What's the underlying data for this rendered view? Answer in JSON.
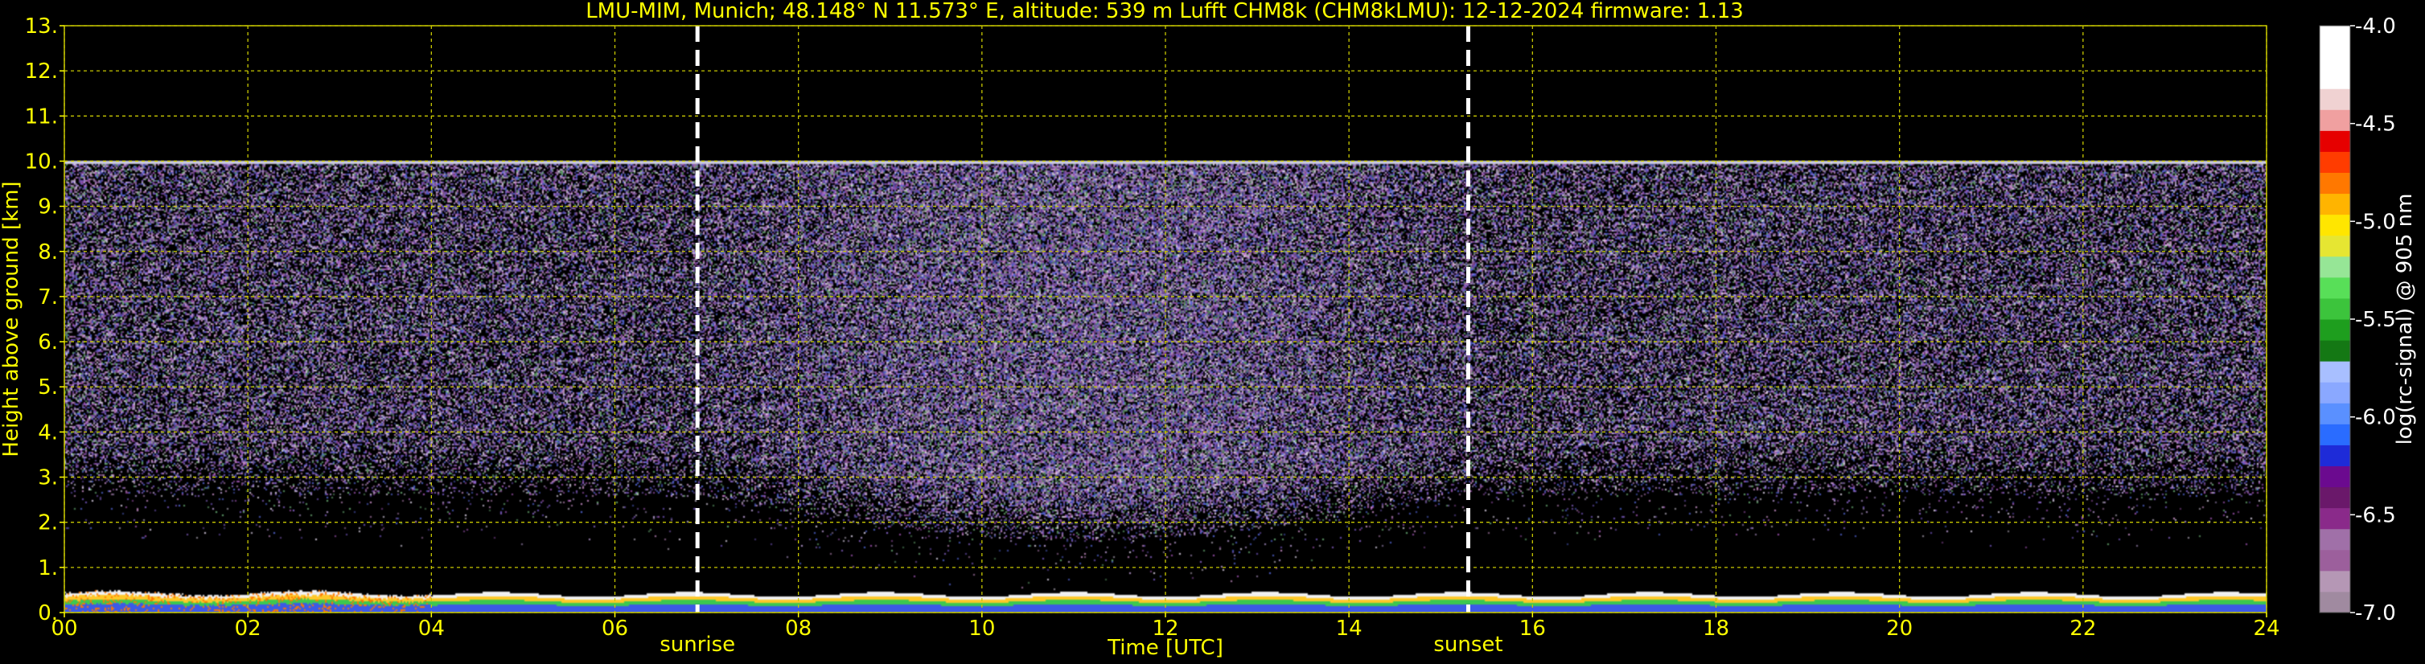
{
  "chart_data": {
    "type": "heatmap",
    "title": "LMU-MIM, Munich; 48.148° N 11.573° E, altitude: 539 m    Lufft CHM8k (CHM8kLMU): 12-12-2024    firmware: 1.13",
    "xlabel": "Time [UTC]",
    "ylabel": "Height above ground [km]",
    "colorbar_label": "log(rc-signal) @ 905 nm",
    "xlim": [
      0,
      24
    ],
    "ylim": [
      0,
      13
    ],
    "x_ticks": [
      "00",
      "02",
      "04",
      "06",
      "08",
      "10",
      "12",
      "14",
      "16",
      "18",
      "20",
      "22",
      "24"
    ],
    "y_ticks": [
      "0.",
      "1.",
      "2.",
      "3.",
      "4.",
      "5.",
      "6.",
      "7.",
      "8.",
      "9.",
      "10.",
      "11.",
      "12.",
      "13."
    ],
    "colorbar_ticks": [
      "-4.0",
      "-4.5",
      "-5.0",
      "-5.5",
      "-6.0",
      "-6.5",
      "-7.0"
    ],
    "clim": [
      -7.0,
      -4.0
    ],
    "grid": true,
    "markers": [
      {
        "label": "sunrise",
        "time": 6.9
      },
      {
        "label": "sunset",
        "time": 15.3
      }
    ],
    "signal_top_km": 10.0,
    "aerosol_layer_top_km": 0.4,
    "colors": {
      "text": "#ffff00",
      "grid": "#c8c800",
      "marker": "#ffffff",
      "background": "#000000"
    },
    "colormap": [
      "#a08aa0",
      "#b597b5",
      "#9c5f9c",
      "#a070a8",
      "#8a2a8a",
      "#6a186a",
      "#6b0a8f",
      "#1e2bd8",
      "#2a6cff",
      "#5a90ff",
      "#8aa8ff",
      "#a8bfff",
      "#147814",
      "#1e9e1e",
      "#3cc43c",
      "#58df58",
      "#96e696",
      "#e6e632",
      "#ffe600",
      "#ffb400",
      "#ff7800",
      "#ff3c00",
      "#e60000",
      "#f0a0a0",
      "#f0d2d2",
      "#ffffff",
      "#ffffff",
      "#ffffff"
    ]
  }
}
